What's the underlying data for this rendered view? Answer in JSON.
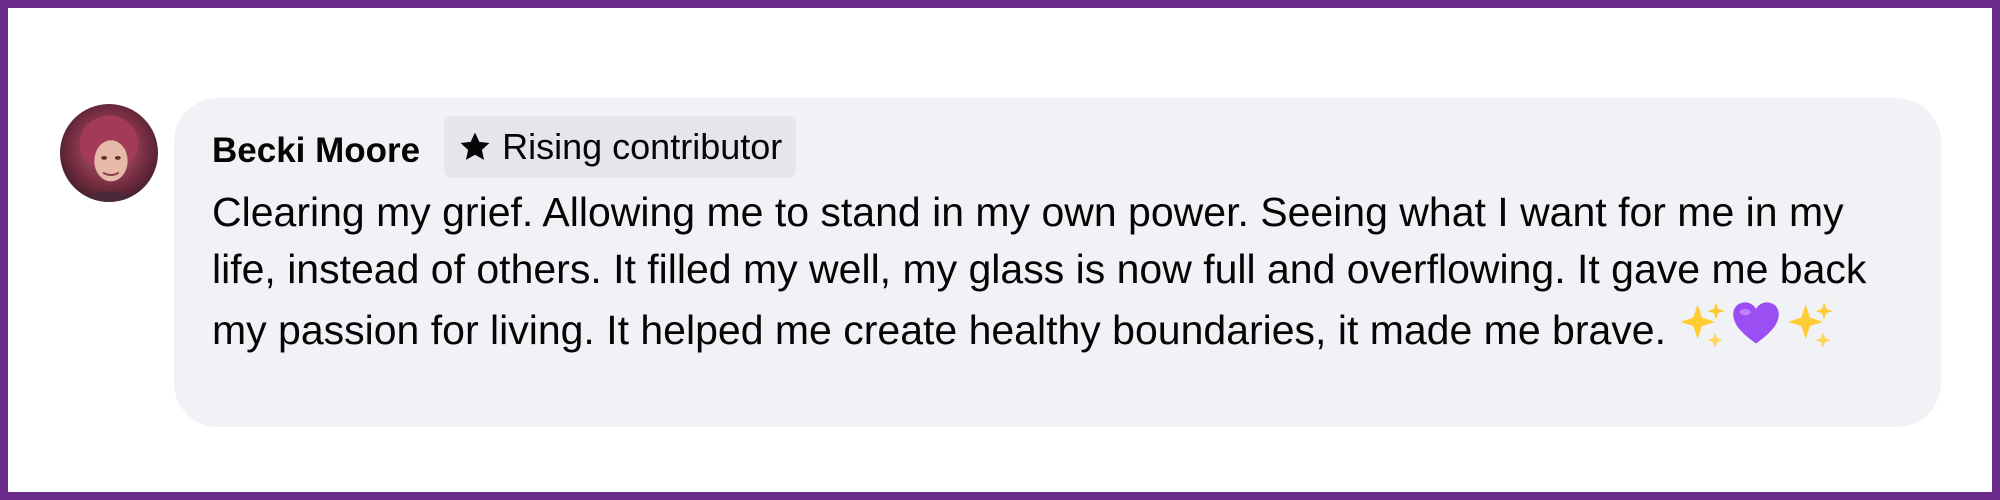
{
  "comment": {
    "author": "Becki Moore",
    "badge_label": "Rising contributor",
    "badge_icon": "star-icon",
    "text": "Clearing my grief. Allowing me to stand in my own power. Seeing what I want for me in my life, instead of others. It filled my well, my glass is now full and overflowing. It gave me back my passion for living. It helped me create healthy boundaries, it made me brave.",
    "emojis": [
      "sparkles-icon",
      "purple-heart-icon",
      "sparkles-icon"
    ]
  },
  "colors": {
    "frame_border": "#6a2d8c",
    "bubble_background": "#f0f2f5",
    "badge_background": "#e4e6eb",
    "text": "#050505"
  }
}
